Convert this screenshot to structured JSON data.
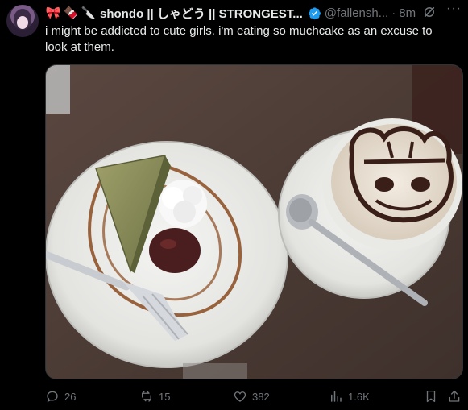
{
  "author": {
    "emojis": [
      "🎀",
      "🍫",
      "🔪"
    ],
    "display_name": "shondo || しゃどう || STRONGEST...",
    "handle": "@fallensh...",
    "separator": "·",
    "time": "8m"
  },
  "tweet": {
    "text": "i might be addicted to cute girls. i'm eating so muchcake as an excuse to look at them."
  },
  "actions": {
    "replies": "26",
    "reposts": "15",
    "likes": "382",
    "views": "1.6K"
  },
  "colors": {
    "background": "#000000",
    "text": "#e7e9ea",
    "muted": "#71767b",
    "verified": "#1d9bf0"
  }
}
